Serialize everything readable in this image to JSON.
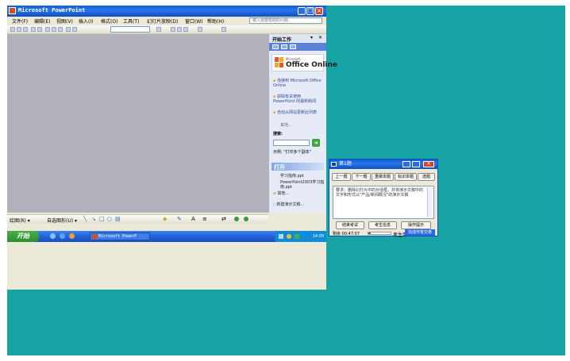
{
  "app": {
    "title": "Microsoft PowerPoint",
    "menu": [
      "文件(F)",
      "编辑(E)",
      "视图(V)",
      "插入(I)",
      "格式(O)",
      "工具(T)",
      "幻灯片放映(D)",
      "窗口(W)",
      "帮助(H)"
    ],
    "help_placeholder": "键入需要帮助的问题"
  },
  "taskpane": {
    "title": "开始工作",
    "logo_text": "Office Online",
    "logo_small": "Microsoft",
    "links": [
      "连接到 Microsoft Office Online",
      "获取有关使用 PowerPoint 的最新新闻",
      "自动从网站更新此列表"
    ],
    "more": "其他...",
    "search_label": "搜索:",
    "example": "示例: \"打印多个副本\"",
    "open_header": "打开",
    "recent_files": [
      "学习指南.ppt",
      "PowerPoint2003学习指南.ppt"
    ],
    "open_more": "其他...",
    "new_presentation": "新建演示文稿..."
  },
  "drawbar": {
    "draw_label": "绘图(R) ▾",
    "autoshapes_label": "自选图形(U) ▾"
  },
  "taskbar": {
    "start": "开始",
    "task_item": "Microsoft PowerP",
    "clock": "14:09"
  },
  "quiz": {
    "title": "第1题",
    "nav_buttons": [
      "上一题",
      "下一题",
      "重做本题",
      "标识本题",
      "选题"
    ],
    "question": "要求：删除幻灯片中的对话框，并将演示文稿中的文字和形式以\"产品/新闻概况\"的演示文稿",
    "action_buttons": [
      "结束考试",
      "考生信息",
      "操作提示"
    ],
    "remaining": "剩余 00:47:07",
    "candidate": "考生甲",
    "submit": "完成作答交卷",
    "progress": 0.1
  }
}
